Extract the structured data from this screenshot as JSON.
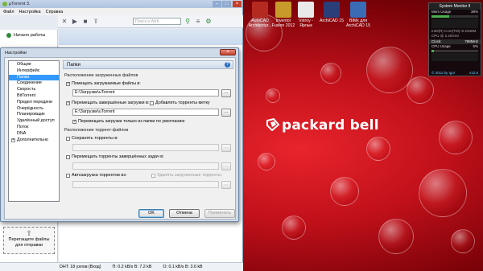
{
  "utorrent": {
    "title": "µTorrent 3.",
    "menu": [
      "Файл",
      "Настройка",
      "Справка"
    ],
    "search_placeholder": "Поиск в Web",
    "start_label": "Начало работы",
    "drop_label_1": "Перетащите файлы",
    "drop_label_2": "для отправки",
    "status": {
      "dht": "DHT: 18 узлов (Вход)",
      "down": "П: 0.2 kB/s В: 7.2 kB",
      "up": "О: 0.1 kB/s В: 3.6 kB"
    }
  },
  "settings": {
    "title": "Настройки",
    "close": "×",
    "tree": [
      "Общие",
      "Интерфейс",
      "Папки",
      "Соединение",
      "Скорость",
      "BitTorrent",
      "Предел передачи",
      "Очерёдность",
      "Планировщик",
      "Удалённый доступ",
      "Поток",
      "DNA",
      "Дополнительно"
    ],
    "selected_index": 2,
    "panel": {
      "header": "Папки",
      "help": "?",
      "downloaded_section": "Расположение загруженных файлов",
      "put_downloads": "Помещать загружаемые файлы в:",
      "path1": "E:\\Загрузки\\uTorrent",
      "move_completed": "Перемещать завершённые загрузки в:",
      "append_label": "Добавлять торренты метку",
      "path2": "E:\\Загрузки\\uTorrent",
      "move_only_default": "Перемещать загрузки только из папки по умолчанию",
      "torrent_section": "Расположение торрент-файлов",
      "store_torrents": "Сохранять торренты в:",
      "move_completed_torrents": "Перемещать торренты завершённых задач в:",
      "autoload": "Автозагрузка торрентов из:",
      "delete_loaded": "Удалять загруженные торренты",
      "browse": "..."
    },
    "buttons": {
      "ok": "OK",
      "cancel": "Отмена",
      "apply": "Применить"
    }
  },
  "desktop": {
    "brand": "packard bell",
    "icons": [
      {
        "label1": "AutoCAD",
        "label2": "Architectur...",
        "color": "#b52a20"
      },
      {
        "label1": "Inventor",
        "label2": "Fusion 2012",
        "color": "#c89a2a"
      },
      {
        "label1": "Vstroy -",
        "label2": "Ярлык",
        "color": "#e9e9e9"
      },
      {
        "label1": "ArchiCAD 15",
        "label2": "",
        "color": "#2a3f7a"
      },
      {
        "label1": "BIMx для",
        "label2": "ArchiCAD 15",
        "color": "#3a6bb5"
      }
    ]
  },
  "gadget": {
    "title": "System Monitor II",
    "mem_label": "Mem Usage",
    "mem_value": "38%",
    "mem_fill": 0.38,
    "cpu_name": "Intel(R) Core(TM) i3-2330M",
    "cpu_freq": "CPU @ 2.20GHz",
    "clock_label": "Clock:",
    "clock_value": "798MHz",
    "cpu_label": "CPU Usage",
    "cpu_value": "5%",
    "cpu_fill": 0.05,
    "footer_left": "© 2011 by Igor",
    "footer_right": "v12.6"
  }
}
